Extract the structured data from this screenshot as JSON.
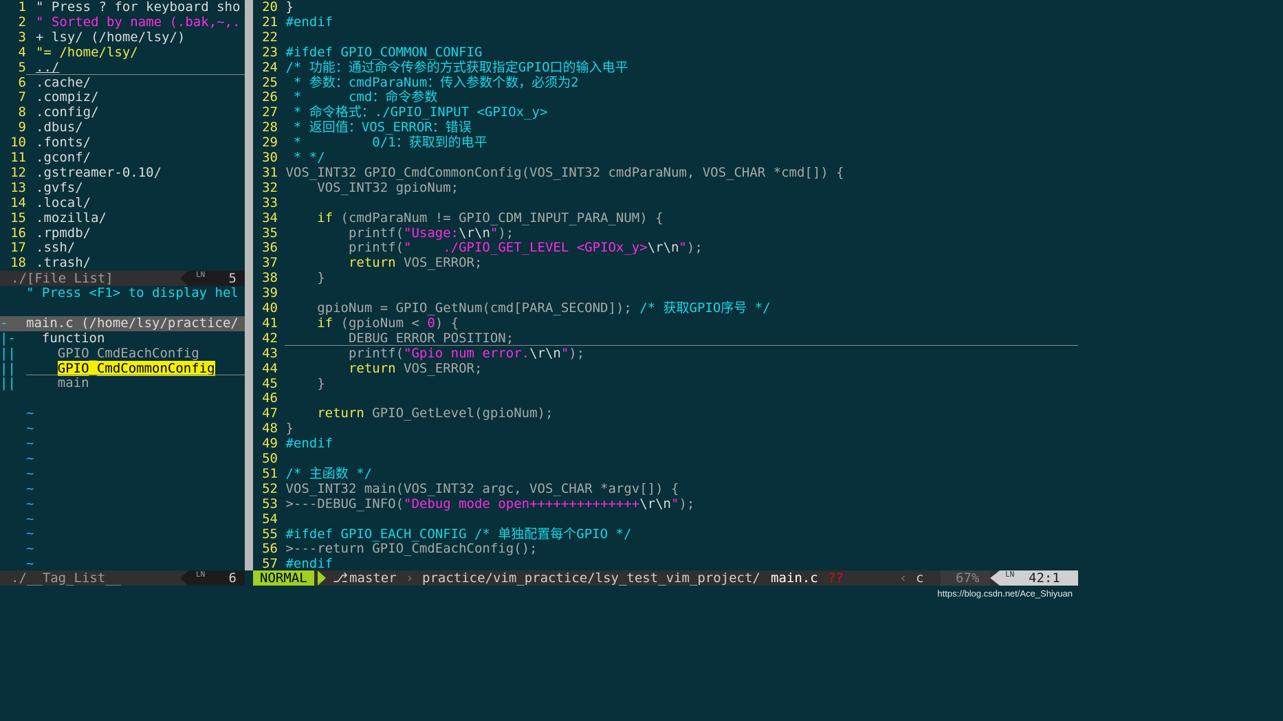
{
  "file_list": {
    "lines": [
      {
        "n": "1",
        "t": "\" Press ? for keyboard sho"
      },
      {
        "n": "2",
        "t": "\" Sorted by name (.bak,~,."
      },
      {
        "n": "3",
        "t": "+ lsy/ (/home/lsy/)"
      },
      {
        "n": "4",
        "t": "\"= /home/lsy/"
      },
      {
        "n": "5",
        "t": "../"
      },
      {
        "n": "6",
        "t": ".cache/"
      },
      {
        "n": "7",
        "t": ".compiz/"
      },
      {
        "n": "8",
        "t": ".config/"
      },
      {
        "n": "9",
        "t": ".dbus/"
      },
      {
        "n": "10",
        "t": ".fonts/"
      },
      {
        "n": "11",
        "t": ".gconf/"
      },
      {
        "n": "12",
        "t": ".gstreamer-0.10/"
      },
      {
        "n": "13",
        "t": ".gvfs/"
      },
      {
        "n": "14",
        "t": ".local/"
      },
      {
        "n": "15",
        "t": ".mozilla/"
      },
      {
        "n": "16",
        "t": ".rpmdb/"
      },
      {
        "n": "17",
        "t": ".ssh/"
      },
      {
        "n": "18",
        "t": ".trash/"
      }
    ],
    "status": {
      "name": "./[File List]",
      "ln_icon": "LN",
      "line": "5"
    }
  },
  "tag_list": {
    "lines": [
      {
        "g": "",
        "t": "\" Press <F1> to display hel"
      },
      {
        "g": "",
        "t": ""
      },
      {
        "g": "-",
        "t": "main.c (/home/lsy/practice/"
      },
      {
        "g": "|-",
        "t": "  function"
      },
      {
        "g": "||",
        "t": "    GPIO_CmdEachConfig"
      },
      {
        "g": "||",
        "t": "GPIO_CmdCommonConfig"
      },
      {
        "g": "||",
        "t": "    main"
      }
    ],
    "tildes": [
      "~",
      "~",
      "~",
      "~",
      "~",
      "~",
      "~",
      "~",
      "~",
      "~",
      "~"
    ],
    "status": {
      "name": "./__Tag_List__",
      "ln_icon": "LN",
      "line": "6"
    }
  },
  "code": {
    "lines": [
      {
        "n": "20",
        "p": [
          {
            "c": "white",
            "t": "}"
          }
        ]
      },
      {
        "n": "21",
        "p": [
          {
            "c": "cyan",
            "t": "#endif"
          }
        ]
      },
      {
        "n": "22",
        "p": []
      },
      {
        "n": "23",
        "p": [
          {
            "c": "cyan",
            "t": "#ifdef GPIO_COMMON_CONFIG"
          }
        ]
      },
      {
        "n": "24",
        "p": [
          {
            "c": "cyan",
            "t": "/* 功能：通过命令传参的方式获取指定GPIO口的输入电平"
          }
        ]
      },
      {
        "n": "25",
        "p": [
          {
            "c": "cyan",
            "t": " * 参数：cmdParaNum：传入参数个数，必须为2"
          }
        ]
      },
      {
        "n": "26",
        "p": [
          {
            "c": "cyan",
            "t": " *      cmd：命令参数"
          }
        ]
      },
      {
        "n": "27",
        "p": [
          {
            "c": "cyan",
            "t": " * 命令格式：./GPIO_INPUT <GPIOx_y>"
          }
        ]
      },
      {
        "n": "28",
        "p": [
          {
            "c": "cyan",
            "t": " * 返回值：VOS_ERROR：错误"
          }
        ]
      },
      {
        "n": "29",
        "p": [
          {
            "c": "cyan",
            "t": " *         0/1：获取到的电平"
          }
        ]
      },
      {
        "n": "30",
        "p": [
          {
            "c": "cyan",
            "t": " * */"
          }
        ]
      },
      {
        "n": "31",
        "p": [
          {
            "c": "grey",
            "t": "VOS_INT32 GPIO_CmdCommonConfig(VOS_INT32 cmdParaNum, VOS_CHAR *cmd[]) {"
          }
        ]
      },
      {
        "n": "32",
        "p": [
          {
            "c": "grey",
            "t": "    VOS_INT32 gpioNum;"
          }
        ]
      },
      {
        "n": "33",
        "p": []
      },
      {
        "n": "34",
        "p": [
          {
            "c": "yellow",
            "t": "    if "
          },
          {
            "c": "grey",
            "t": "(cmdParaNum != GPIO_CDM_INPUT_PARA_NUM) {"
          }
        ]
      },
      {
        "n": "35",
        "p": [
          {
            "c": "grey",
            "t": "        printf("
          },
          {
            "c": "magenta",
            "t": "\"Usage:"
          },
          {
            "c": "white",
            "t": "\\r\\n"
          },
          {
            "c": "magenta",
            "t": "\""
          },
          {
            "c": "grey",
            "t": ");"
          }
        ]
      },
      {
        "n": "36",
        "p": [
          {
            "c": "grey",
            "t": "        printf("
          },
          {
            "c": "magenta",
            "t": "\"    ./GPIO_GET_LEVEL <GPIOx_y>"
          },
          {
            "c": "white",
            "t": "\\r\\n"
          },
          {
            "c": "magenta",
            "t": "\""
          },
          {
            "c": "grey",
            "t": ");"
          }
        ]
      },
      {
        "n": "37",
        "p": [
          {
            "c": "yellow",
            "t": "        return "
          },
          {
            "c": "grey",
            "t": "VOS_ERROR;"
          }
        ]
      },
      {
        "n": "38",
        "p": [
          {
            "c": "grey",
            "t": "    }"
          }
        ]
      },
      {
        "n": "39",
        "p": []
      },
      {
        "n": "40",
        "p": [
          {
            "c": "grey",
            "t": "    gpioNum = GPIO_GetNum(cmd[PARA_SECOND]); "
          },
          {
            "c": "cyan",
            "t": "/* 获取GPIO序号 */"
          }
        ]
      },
      {
        "n": "41",
        "p": [
          {
            "c": "yellow",
            "t": "    if "
          },
          {
            "c": "grey",
            "t": "(gpioNum < "
          },
          {
            "c": "magenta",
            "t": "0"
          },
          {
            "c": "grey",
            "t": ") {"
          }
        ]
      },
      {
        "n": "42",
        "p": [
          {
            "c": "grey",
            "t": "        DEBUG_ERROR_POSITION;"
          }
        ]
      },
      {
        "n": "43",
        "p": [
          {
            "c": "grey",
            "t": "        printf("
          },
          {
            "c": "magenta",
            "t": "\"Gpio num error."
          },
          {
            "c": "white",
            "t": "\\r\\n"
          },
          {
            "c": "magenta",
            "t": "\""
          },
          {
            "c": "grey",
            "t": ");"
          }
        ]
      },
      {
        "n": "44",
        "p": [
          {
            "c": "yellow",
            "t": "        return "
          },
          {
            "c": "grey",
            "t": "VOS_ERROR;"
          }
        ]
      },
      {
        "n": "45",
        "p": [
          {
            "c": "grey",
            "t": "    }"
          }
        ]
      },
      {
        "n": "46",
        "p": []
      },
      {
        "n": "47",
        "p": [
          {
            "c": "yellow",
            "t": "    return "
          },
          {
            "c": "grey",
            "t": "GPIO_GetLevel(gpioNum);"
          }
        ]
      },
      {
        "n": "48",
        "p": [
          {
            "c": "grey",
            "t": "}"
          }
        ]
      },
      {
        "n": "49",
        "p": [
          {
            "c": "cyan",
            "t": "#endif"
          }
        ]
      },
      {
        "n": "50",
        "p": []
      },
      {
        "n": "51",
        "p": [
          {
            "c": "cyan",
            "t": "/* 主函数 */"
          }
        ]
      },
      {
        "n": "52",
        "p": [
          {
            "c": "grey",
            "t": "VOS_INT32 main(VOS_INT32 argc, VOS_CHAR *argv[]) {"
          }
        ]
      },
      {
        "n": "53",
        "p": [
          {
            "c": "grey",
            "t": ">---DEBUG_INFO("
          },
          {
            "c": "magenta",
            "t": "\"Debug mode open++++++++++++++"
          },
          {
            "c": "white",
            "t": "\\r\\n"
          },
          {
            "c": "magenta",
            "t": "\""
          },
          {
            "c": "grey",
            "t": ");"
          }
        ]
      },
      {
        "n": "54",
        "p": []
      },
      {
        "n": "55",
        "p": [
          {
            "c": "cyan",
            "t": "#ifdef GPIO_EACH_CONFIG /* 单独配置每个GPIO */"
          }
        ]
      },
      {
        "n": "56",
        "p": [
          {
            "c": "grey",
            "t": ">---return GPIO_CmdEachConfig();"
          }
        ]
      },
      {
        "n": "57",
        "p": [
          {
            "c": "cyan",
            "t": "#endif"
          }
        ]
      }
    ]
  },
  "statusbar": {
    "mode": "NORMAL",
    "branch_icon": "git-branch-icon",
    "branch": "master",
    "path": "practice/vim_practice/lsy_test_vim_project/",
    "file": "main.c",
    "flags": "??",
    "filetype": "c",
    "percent": "67%",
    "ln_icon": "LN",
    "position": "42:1"
  },
  "watermark": "https://blog.csdn.net/Ace_Shiyuan",
  "colors": {
    "bg": "#07303a",
    "linenr": "#f5e64a",
    "string": "#ff2be3",
    "comment": "#1ad6e6",
    "keyword": "#f5e64a",
    "mode": "#a0d020",
    "search": "#f5ef00"
  }
}
